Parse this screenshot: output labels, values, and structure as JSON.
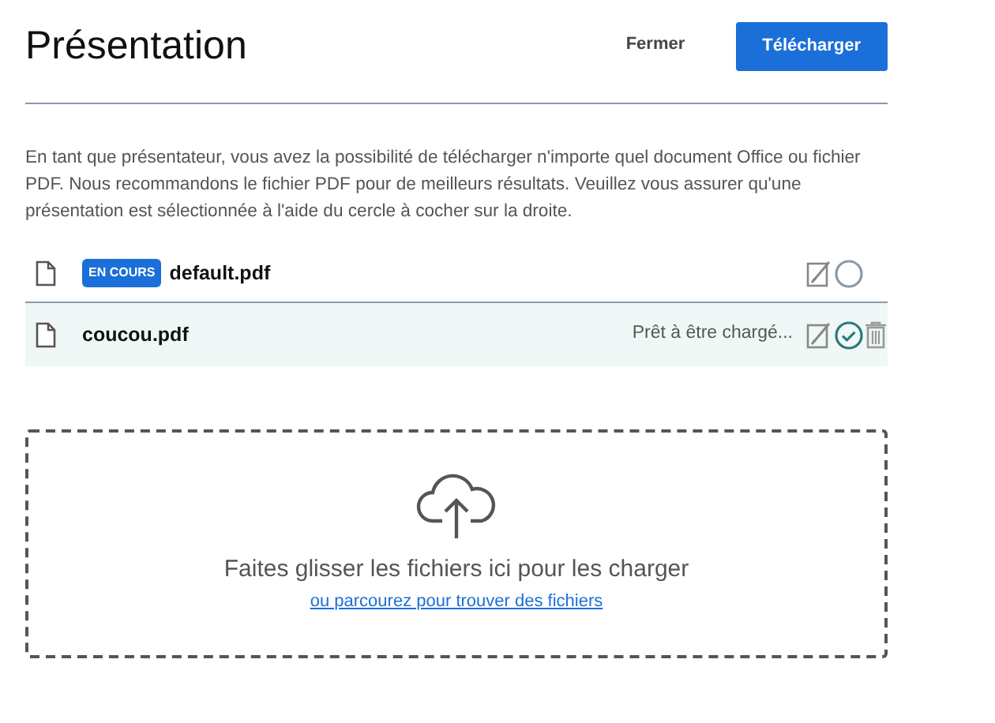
{
  "title": "Présentation",
  "buttons": {
    "close": "Fermer",
    "upload": "Télécharger"
  },
  "description": "En tant que présentateur, vous avez la possibilité de télécharger n'importe quel document Office ou fichier PDF. Nous recommandons le fichier PDF pour de meilleurs résultats. Veuillez vous assurer qu'une présentation est sélectionnée à l'aide du cercle à cocher sur la droite.",
  "files": [
    {
      "name": "default.pdf",
      "badge": "EN COURS",
      "selected": false,
      "removable": false
    },
    {
      "name": "coucou.pdf",
      "status": "Prêt à être chargé...",
      "selected": true,
      "removable": true
    }
  ],
  "dropzone": {
    "message": "Faites glisser les fichiers ici pour les charger",
    "browse_link": "ou parcourez pour trouver des fichiers"
  }
}
